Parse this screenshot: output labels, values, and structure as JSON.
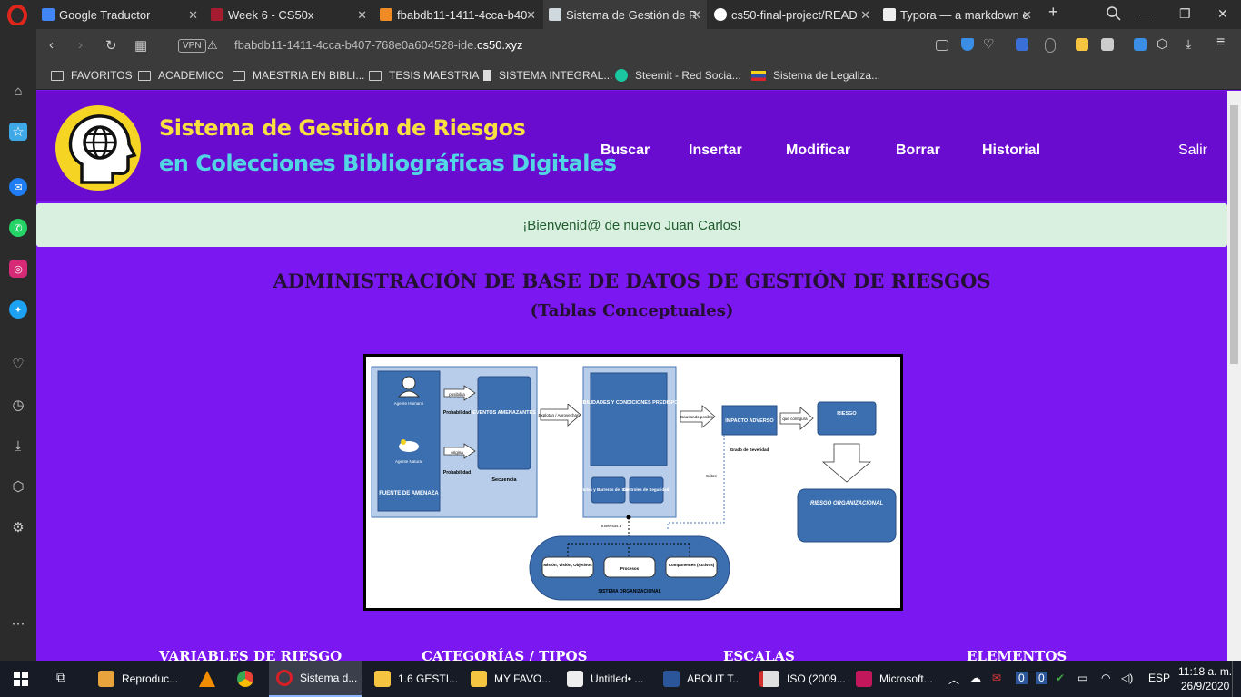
{
  "browser": {
    "tabs": [
      {
        "title": "Google Traductor",
        "favicon_color": "#4285f4"
      },
      {
        "title": "Week 6 - CS50x",
        "favicon_color": "#a51c30"
      },
      {
        "title": "fbabdb11-1411-4cca-b40",
        "favicon_color": "#f08a24"
      },
      {
        "title": "Sistema de Gestión de R",
        "favicon_color": "#6a0bd0"
      },
      {
        "title": "cs50-final-project/READ",
        "favicon_color": "#ffffff"
      },
      {
        "title": "Typora — a markdown e",
        "favicon_color": "#eeeeee"
      }
    ],
    "new_tab_label": "+",
    "vpn_label": "VPN",
    "url_prefix": "fbabdb11-1411-4cca-b407-768e0a604528-ide.",
    "url_domain": "cs50.xyz",
    "bookmarks": [
      "FAVORITOS",
      "ACADEMICO",
      "MAESTRIA EN BIBLI...",
      "TESIS MAESTRIA",
      "SISTEMA INTEGRAL...",
      "Steemit - Red Socia...",
      "Sistema de Legaliza..."
    ]
  },
  "site": {
    "title_line1": "Sistema de Gestión de Riesgos",
    "title_line2": "en Colecciones Bibliográficas Digitales",
    "nav": [
      "Buscar",
      "Insertar",
      "Modificar",
      "Borrar",
      "Historial"
    ],
    "logout": "Salir",
    "welcome": "¡Bienvenid@ de nuevo Juan Carlos!",
    "heading": "ADMINISTRACIÓN DE BASE DE DATOS DE GESTIÓN DE RIESGOS",
    "subheading": "(Tablas Conceptuales)",
    "columns": [
      "VARIABLES DE RIESGO",
      "CATEGORÍAS / TIPOS",
      "ESCALAS",
      "ELEMENTOS"
    ]
  },
  "diagram": {
    "fuente_label": "FUENTE DE AMENAZA",
    "agente_humano": "Agente Humano",
    "agente_natural": "Agente Natural",
    "posibilita": "posibilita",
    "origina": "origina",
    "probabilidad": "Probabilidad",
    "eventos": "EVENTOS AMENAZANTES",
    "secuencia": "Secuencia",
    "explotan": "Explotan / Aprovechan",
    "vulnerabilidades": "VULNERABILIDADES Y CONDICIONES PREDISPONENTES",
    "limites": "Límites y Barreras del Sistema",
    "controles": "Controles de Seguridad",
    "causando": "Causando posible",
    "impacto": "IMPACTO ADVERSO",
    "grado_severidad": "Grado de Severidad",
    "que_configura": "que configura",
    "riesgo": "RIESGO",
    "riesgo_org": "RIESGO ORGANIZACIONAL",
    "sobre": "Sobre",
    "mision": "Misión, Visión, Objetivos",
    "procesos": "Procesos",
    "componentes": "Componentes (Activos)",
    "sistema_org": "SISTEMA ORGANIZACIONAL",
    "inmersos": "Inmersos a"
  },
  "taskbar": {
    "items": [
      {
        "label": "Reproduc...",
        "color": "#e8a33d"
      },
      {
        "label": "",
        "color": "#f28c00"
      },
      {
        "label": "",
        "color": "#e94235"
      },
      {
        "label": "Sistema d...",
        "color": "#d81f26"
      },
      {
        "label": "1.6 GESTI...",
        "color": "#f5c542"
      },
      {
        "label": "MY FAVO...",
        "color": "#f5c542"
      },
      {
        "label": "Untitled• ...",
        "color": "#eeeeee"
      },
      {
        "label": "ABOUT T...",
        "color": "#2b579a"
      },
      {
        "label": "ISO (2009...",
        "color": "#e0e0e0"
      },
      {
        "label": "Microsoft...",
        "color": "#c2185b"
      }
    ],
    "lang": "ESP",
    "time": "11:18 a. m.",
    "date": "26/9/2020"
  }
}
